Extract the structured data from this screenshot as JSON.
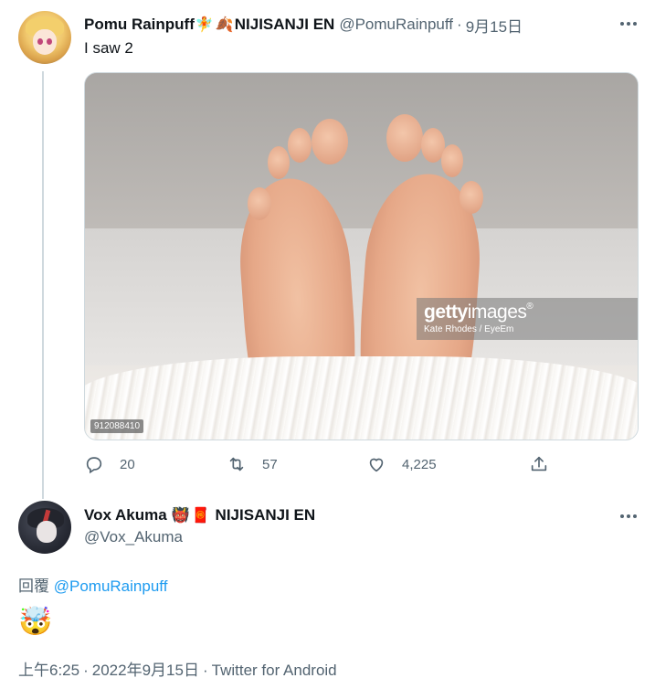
{
  "tweet1": {
    "author_name": "Pomu Rainpuff",
    "name_emojis": [
      "🧚",
      "🍂"
    ],
    "name_suffix": "NIJISANJI EN",
    "handle": "@PomuRainpuff",
    "separator": "·",
    "date": "9月15日",
    "text": "I saw 2",
    "media": {
      "watermark_brand": "getty",
      "watermark_suffix": "images",
      "watermark_mark": "®",
      "credit": "Kate Rhodes / EyeEm",
      "image_id": "912088410"
    },
    "actions": {
      "reply_icon": "reply-icon",
      "reply_count": "20",
      "retweet_icon": "retweet-icon",
      "retweet_count": "57",
      "like_icon": "heart-icon",
      "like_count": "4,225",
      "share_icon": "share-icon"
    }
  },
  "tweet2": {
    "author_name": "Vox Akuma",
    "name_emojis": [
      "👹",
      "🧧"
    ],
    "name_suffix": "NIJISANJI EN",
    "handle": "@Vox_Akuma",
    "reply_prefix": "回覆",
    "reply_mention": "@PomuRainpuff",
    "body_emoji": "🤯",
    "time": "上午6:25",
    "sep": "·",
    "date": "2022年9月15日",
    "source": "Twitter for Android"
  },
  "colors": {
    "text": "#0f1419",
    "secondary": "#536471",
    "link": "#1d9bf0",
    "border": "#cfd9de"
  }
}
